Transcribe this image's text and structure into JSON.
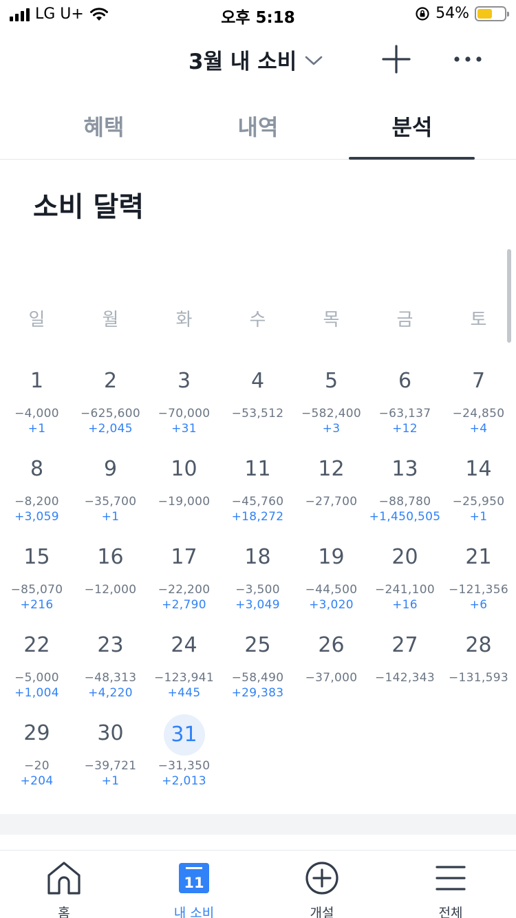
{
  "status_bar": {
    "carrier": "LG U+",
    "time": "오후 5:18",
    "battery": "54%",
    "battery_level": 0.54
  },
  "header": {
    "month_title": "3월 내 소비"
  },
  "tabs": [
    {
      "label": "혜택"
    },
    {
      "label": "내역"
    },
    {
      "label": "분석"
    }
  ],
  "active_tab": "분석",
  "section_title": "소비 달력",
  "weekdays": [
    "일",
    "월",
    "화",
    "수",
    "목",
    "금",
    "토"
  ],
  "calendar": {
    "today": 31,
    "days": [
      {
        "day": "1",
        "spend": "−4,000",
        "earn": "+1"
      },
      {
        "day": "2",
        "spend": "−625,600",
        "earn": "+2,045"
      },
      {
        "day": "3",
        "spend": "−70,000",
        "earn": "+31"
      },
      {
        "day": "4",
        "spend": "−53,512",
        "earn": ""
      },
      {
        "day": "5",
        "spend": "−582,400",
        "earn": "+3"
      },
      {
        "day": "6",
        "spend": "−63,137",
        "earn": "+12"
      },
      {
        "day": "7",
        "spend": "−24,850",
        "earn": "+4"
      },
      {
        "day": "8",
        "spend": "−8,200",
        "earn": "+3,059"
      },
      {
        "day": "9",
        "spend": "−35,700",
        "earn": "+1"
      },
      {
        "day": "10",
        "spend": "−19,000",
        "earn": ""
      },
      {
        "day": "11",
        "spend": "−45,760",
        "earn": "+18,272"
      },
      {
        "day": "12",
        "spend": "−27,700",
        "earn": ""
      },
      {
        "day": "13",
        "spend": "−88,780",
        "earn": "+1,450,505"
      },
      {
        "day": "14",
        "spend": "−25,950",
        "earn": "+1"
      },
      {
        "day": "15",
        "spend": "−85,070",
        "earn": "+216"
      },
      {
        "day": "16",
        "spend": "−12,000",
        "earn": ""
      },
      {
        "day": "17",
        "spend": "−22,200",
        "earn": "+2,790"
      },
      {
        "day": "18",
        "spend": "−3,500",
        "earn": "+3,049"
      },
      {
        "day": "19",
        "spend": "−44,500",
        "earn": "+3,020"
      },
      {
        "day": "20",
        "spend": "−241,100",
        "earn": "+16"
      },
      {
        "day": "21",
        "spend": "−121,356",
        "earn": "+6"
      },
      {
        "day": "22",
        "spend": "−5,000",
        "earn": "+1,004"
      },
      {
        "day": "23",
        "spend": "−48,313",
        "earn": "+4,220"
      },
      {
        "day": "24",
        "spend": "−123,941",
        "earn": "+445"
      },
      {
        "day": "25",
        "spend": "−58,490",
        "earn": "+29,383"
      },
      {
        "day": "26",
        "spend": "−37,000",
        "earn": ""
      },
      {
        "day": "27",
        "spend": "−142,343",
        "earn": ""
      },
      {
        "day": "28",
        "spend": "−131,593",
        "earn": ""
      },
      {
        "day": "29",
        "spend": "−20",
        "earn": "+204"
      },
      {
        "day": "30",
        "spend": "−39,721",
        "earn": "+1"
      },
      {
        "day": "31",
        "spend": "−31,350",
        "earn": "+2,013"
      }
    ]
  },
  "bottom_nav": [
    {
      "label": "홈",
      "icon": "home-icon"
    },
    {
      "label": "내 소비",
      "icon": "calendar-icon",
      "badge": "11"
    },
    {
      "label": "개설",
      "icon": "plus-circle-icon"
    },
    {
      "label": "전체",
      "icon": "menu-icon"
    }
  ],
  "colors": {
    "accent": "#3182f6",
    "text_primary": "#191f28",
    "text_secondary": "#6b7684",
    "today_bg": "#e8f0fc"
  }
}
